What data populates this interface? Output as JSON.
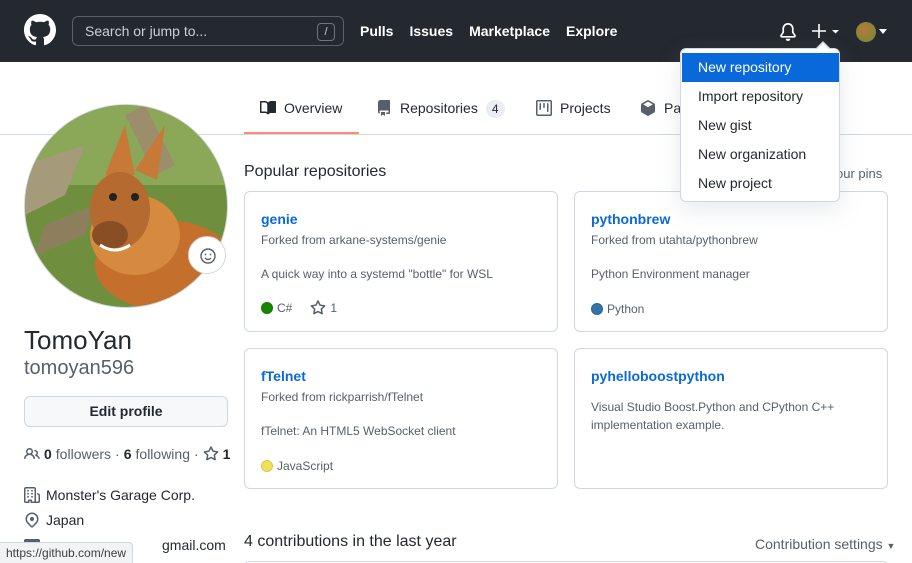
{
  "header": {
    "search_placeholder": "Search or jump to...",
    "search_shortcut": "/",
    "nav": [
      "Pulls",
      "Issues",
      "Marketplace",
      "Explore"
    ]
  },
  "tabs": [
    {
      "label": "Overview",
      "icon": "book-icon",
      "active": true
    },
    {
      "label": "Repositories",
      "icon": "repo-icon",
      "count": "4"
    },
    {
      "label": "Projects",
      "icon": "project-icon"
    },
    {
      "label": "Pa",
      "icon": "package-icon"
    }
  ],
  "profile": {
    "fullname": "TomoYan",
    "username": "tomoyan596",
    "edit_label": "Edit profile",
    "followers_count": "0",
    "followers_label": "followers",
    "following_count": "6",
    "following_label": "following",
    "stars_count": "1",
    "company": "Monster's Garage Corp.",
    "location": "Japan",
    "email": "gmail.com"
  },
  "main": {
    "popular_title": "Popular repositories",
    "pins_link": "our pins",
    "contrib_title": "4 contributions in the last year",
    "contrib_settings": "Contribution settings"
  },
  "repos": [
    {
      "name": "genie",
      "fork": "Forked from arkane-systems/genie",
      "desc": "A quick way into a systemd \"bottle\" for WSL",
      "lang": "C#",
      "lang_color": "#178600",
      "stars": "1"
    },
    {
      "name": "pythonbrew",
      "fork": "Forked from utahta/pythonbrew",
      "desc": "Python Environment manager",
      "lang": "Python",
      "lang_color": "#3572A5"
    },
    {
      "name": "fTelnet",
      "fork": "Forked from rickparrish/fTelnet",
      "desc": "fTelnet: An HTML5 WebSocket client",
      "lang": "JavaScript",
      "lang_color": "#f1e05a"
    },
    {
      "name": "pyhelloboostpython",
      "desc": "Visual Studio Boost.Python and CPython C++ implementation example."
    }
  ],
  "dropdown": {
    "items": [
      "New repository",
      "Import repository",
      "New gist",
      "New organization",
      "New project"
    ],
    "active_index": 0
  },
  "statusbar": {
    "url": "https://github.com/new"
  },
  "colors": {
    "header_bg": "#24292f",
    "accent": "#0969da",
    "tab_underline": "#fd8c73"
  }
}
